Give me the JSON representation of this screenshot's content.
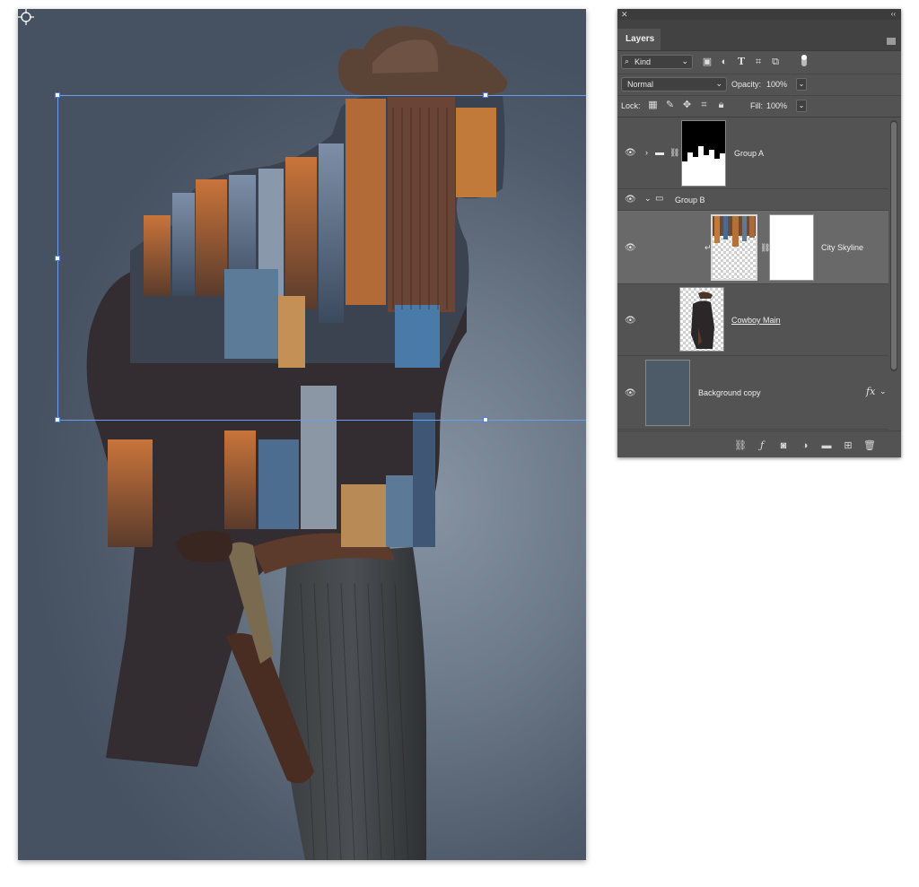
{
  "panel": {
    "tab_label": "Layers",
    "filter": {
      "kind_label": "Kind",
      "icons": [
        "image-filter-icon",
        "adjustment-filter-icon",
        "type-filter-icon",
        "shape-filter-icon",
        "smart-object-filter-icon"
      ]
    },
    "blend_mode": "Normal",
    "opacity_label": "Opacity:",
    "opacity_value": "100%",
    "lock_label": "Lock:",
    "fill_label": "Fill:",
    "fill_value": "100%",
    "layers": [
      {
        "name": "Group A",
        "type": "group",
        "expanded": false
      },
      {
        "name": "Group B",
        "type": "group",
        "expanded": true
      },
      {
        "name": "City Skyline",
        "type": "layer",
        "selected": true,
        "clipped": true
      },
      {
        "name": "Cowboy Main",
        "type": "layer",
        "underlined": true
      },
      {
        "name": "Background copy",
        "type": "layer",
        "has_fx": true
      }
    ],
    "fx_symbol": "fx",
    "bottom_icons": [
      "link-layers-icon",
      "fx-icon",
      "mask-icon",
      "adjustment-layer-icon",
      "new-group-icon",
      "new-layer-icon",
      "trash-icon"
    ]
  },
  "colors": {
    "panel_bg": "#535353",
    "selection_line": "#6c9cf0",
    "canvas_bg": "#6d7a8a"
  }
}
